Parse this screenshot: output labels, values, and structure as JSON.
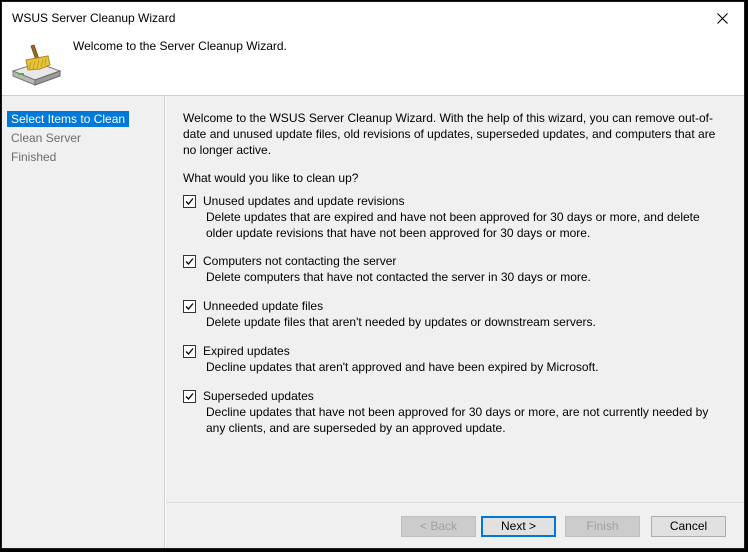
{
  "window": {
    "title": "WSUS Server Cleanup Wizard"
  },
  "header": {
    "text": "Welcome to the Server Cleanup Wizard.",
    "icon": "cleanup-broom-drive-icon"
  },
  "sidebar": {
    "items": [
      {
        "label": "Select Items to Clean",
        "active": true
      },
      {
        "label": "Clean Server",
        "active": false
      },
      {
        "label": "Finished",
        "active": false
      }
    ]
  },
  "content": {
    "intro": "Welcome to the WSUS Server Cleanup Wizard. With the help of this wizard, you can remove out-of-date and unused update files, old revisions of updates, superseded updates, and computers that are no longer active.",
    "question": "What would you like to clean up?",
    "options": [
      {
        "label": "Unused updates and update revisions",
        "checked": true,
        "description": "Delete updates that are expired and have not been approved for 30 days or more, and delete older update revisions that have not been approved for 30 days or more."
      },
      {
        "label": "Computers not contacting the server",
        "checked": true,
        "description": "Delete computers that have not contacted the server in 30 days or more."
      },
      {
        "label": "Unneeded update files",
        "checked": true,
        "description": "Delete update files that aren't needed by updates or downstream servers."
      },
      {
        "label": "Expired updates",
        "checked": true,
        "description": "Decline updates that aren't approved and have been expired by Microsoft."
      },
      {
        "label": "Superseded updates",
        "checked": true,
        "description": "Decline updates that have not been approved for 30 days or more, are not currently needed by any clients, and are superseded by an approved update."
      }
    ]
  },
  "buttons": {
    "back": "< Back",
    "next": "Next >",
    "finish": "Finish",
    "cancel": "Cancel"
  },
  "colors": {
    "accent": "#0078d7",
    "panel": "#f0f0f0"
  }
}
